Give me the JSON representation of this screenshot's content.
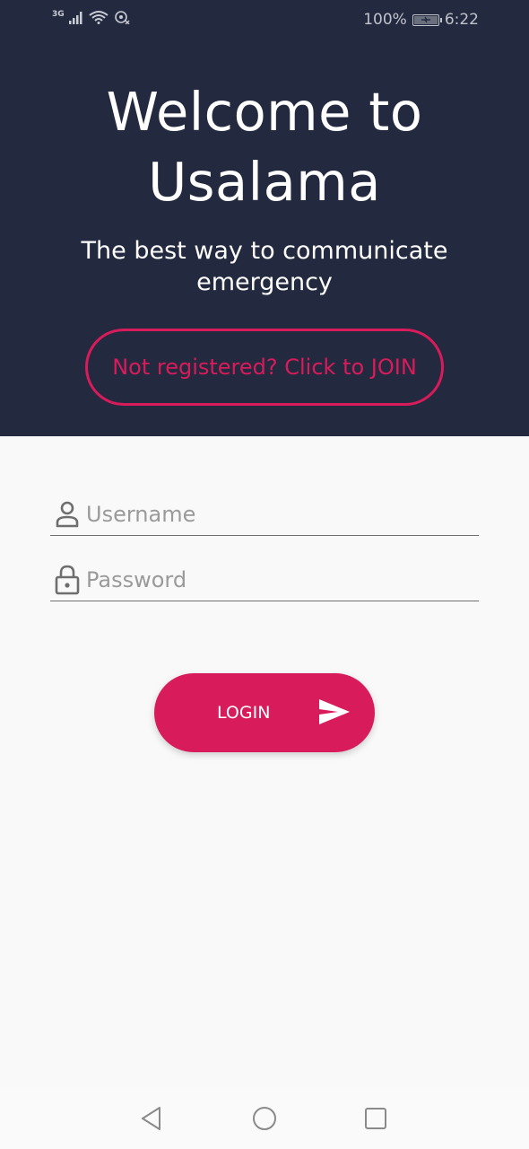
{
  "status_bar": {
    "network": "3G",
    "battery": "100%",
    "battery_level": 1.0,
    "time": "6:22"
  },
  "header": {
    "title_line1": "Welcome to",
    "title_line2": "Usalama",
    "subtitle": "The best way to communicate emergency",
    "join_button": "Not registered? Click to JOIN"
  },
  "form": {
    "username_placeholder": "Username",
    "username_value": "",
    "password_placeholder": "Password",
    "password_value": "",
    "login_button": "LOGIN"
  },
  "colors": {
    "header_bg": "#232a3f",
    "accent": "#d81b5a",
    "page_bg": "#f9f9fa"
  },
  "icons": {
    "username": "person-icon",
    "password": "lock-icon",
    "login": "send-icon",
    "nav": [
      "back-icon",
      "home-icon",
      "recents-icon"
    ]
  }
}
